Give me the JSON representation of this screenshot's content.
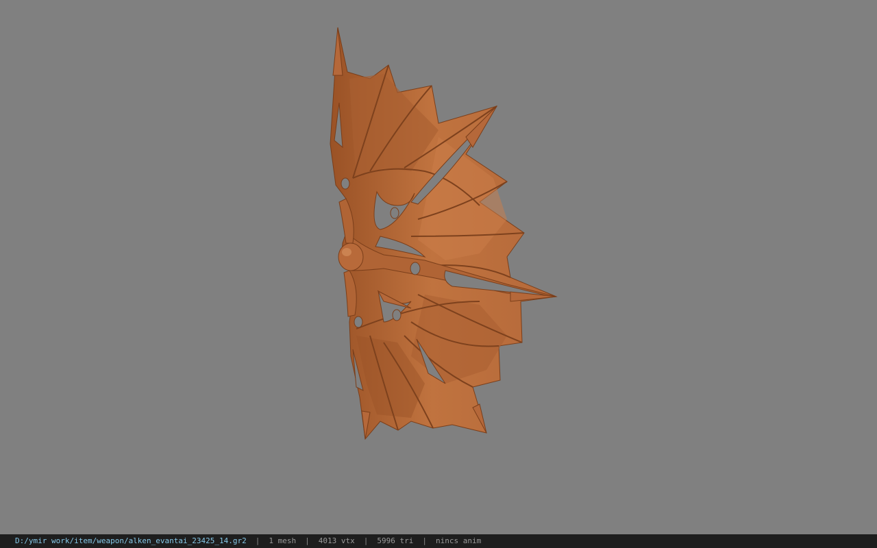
{
  "viewport": {
    "background_color": "#808080",
    "model_color": "#b8693a"
  },
  "status_bar": {
    "file_path": "D:/ymir work/item/weapon/alken_evantai_23425_14.gr2",
    "separator": "|",
    "mesh_count": "1 mesh",
    "vertex_count": "4013 vtx",
    "triangle_count": "5996 tri",
    "animation": "nincs anim"
  }
}
